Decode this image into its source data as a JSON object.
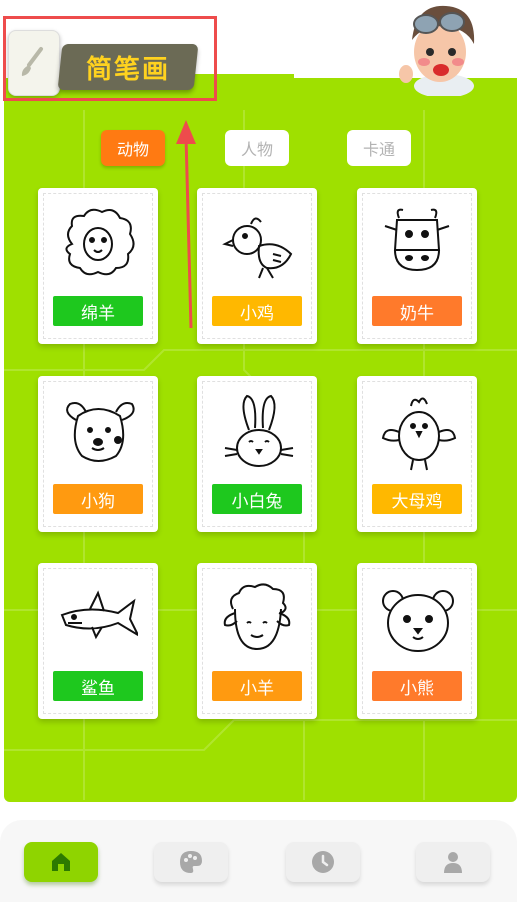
{
  "header": {
    "title": "简笔画"
  },
  "tabs": [
    {
      "label": "动物",
      "active": true
    },
    {
      "label": "人物",
      "active": false
    },
    {
      "label": "卡通",
      "active": false
    }
  ],
  "cards": [
    {
      "label": "绵羊",
      "color": "#1ec81e",
      "icon": "sheep-drawing"
    },
    {
      "label": "小鸡",
      "color": "#ffb800",
      "icon": "chick-drawing"
    },
    {
      "label": "奶牛",
      "color": "#ff7a2b",
      "icon": "cow-drawing"
    },
    {
      "label": "小狗",
      "color": "#ff9a10",
      "icon": "dog-drawing"
    },
    {
      "label": "小白兔",
      "color": "#1ec81e",
      "icon": "rabbit-drawing"
    },
    {
      "label": "大母鸡",
      "color": "#ffb800",
      "icon": "hen-drawing"
    },
    {
      "label": "鲨鱼",
      "color": "#1ec81e",
      "icon": "shark-drawing"
    },
    {
      "label": "小羊",
      "color": "#ff9a10",
      "icon": "lamb-drawing"
    },
    {
      "label": "小熊",
      "color": "#ff7a2b",
      "icon": "bear-drawing"
    }
  ],
  "nav": [
    {
      "icon": "home-icon",
      "active": true
    },
    {
      "icon": "palette-icon",
      "active": false
    },
    {
      "icon": "clock-icon",
      "active": false
    },
    {
      "icon": "user-icon",
      "active": false
    }
  ],
  "colors": {
    "panel": "#9fe000",
    "active_tab": "#ff7a12",
    "annotation": "#ee4c4c"
  }
}
